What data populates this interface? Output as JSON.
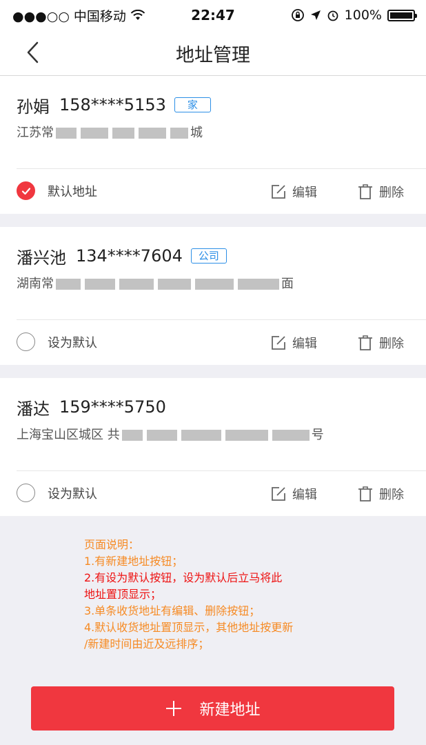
{
  "status_bar": {
    "carrier": "●●●○○ 中国移动",
    "time": "22:47",
    "battery": "100%"
  },
  "nav": {
    "title": "地址管理",
    "back_icon": "chevron-left-icon"
  },
  "addresses": [
    {
      "name": "孙娟",
      "phone": "158****5153",
      "tag": "家",
      "address_prefix": "江苏常",
      "address_suffix": "城",
      "is_default": true,
      "default_label": "默认地址",
      "edit_label": "编辑",
      "delete_label": "删除"
    },
    {
      "name": "潘兴池",
      "phone": "134****7604",
      "tag": "公司",
      "address_prefix": "湖南常",
      "address_suffix": "面",
      "is_default": false,
      "default_label": "设为默认",
      "edit_label": "编辑",
      "delete_label": "删除"
    },
    {
      "name": "潘达",
      "phone": "159****5750",
      "tag": "",
      "address_prefix": "上海宝山区城区 共",
      "address_suffix": "号",
      "is_default": false,
      "default_label": "设为默认",
      "edit_label": "编辑",
      "delete_label": "删除"
    }
  ],
  "page_note": {
    "title": "页面说明：",
    "line1": "1.有新建地址按钮；",
    "line2": "2.有设为默认按钮，设为默认后立马将此",
    "line2b": "地址置顶显示；",
    "line3": "3.单条收货地址有编辑、删除按钮；",
    "line4": "4.默认收货地址置顶显示，其他地址按更新",
    "line4b": "/新建时间由近及远排序；"
  },
  "add_button": {
    "icon": "plus-icon",
    "label": "新建地址"
  },
  "colors": {
    "accent_red": "#f0373f",
    "tag_blue": "#2b8ee6",
    "note_orange": "#f68a23",
    "note_red": "#ee1111"
  }
}
